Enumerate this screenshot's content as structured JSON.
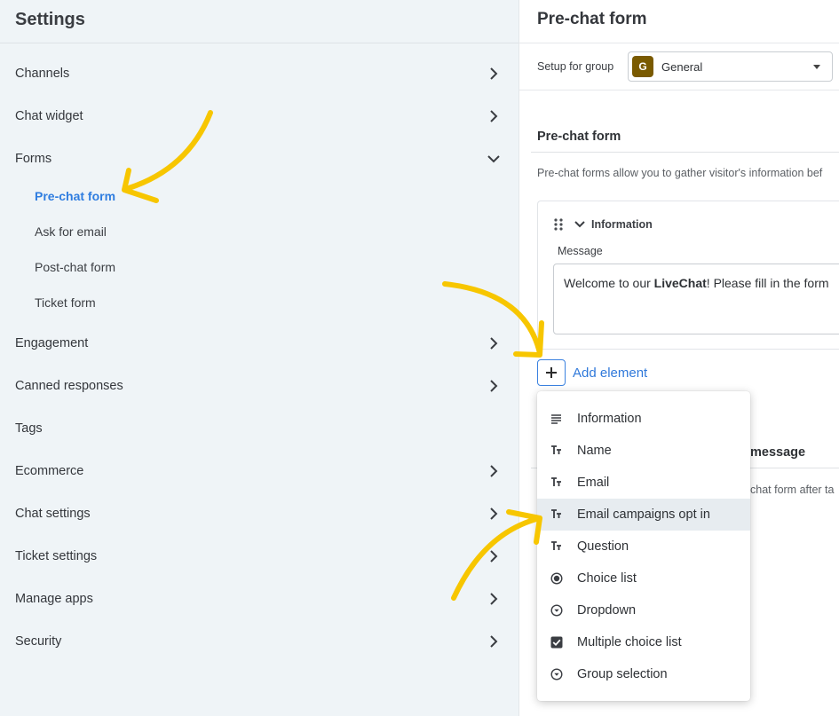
{
  "sidebar": {
    "title": "Settings",
    "items": [
      {
        "label": "Channels",
        "icon": "chevron-right-icon"
      },
      {
        "label": "Chat widget",
        "icon": "chevron-right-icon"
      },
      {
        "label": "Forms",
        "icon": "chevron-down-icon"
      },
      {
        "label": "Engagement",
        "icon": "chevron-right-icon"
      },
      {
        "label": "Canned responses",
        "icon": "chevron-right-icon"
      },
      {
        "label": "Tags"
      },
      {
        "label": "Ecommerce",
        "icon": "chevron-right-icon"
      },
      {
        "label": "Chat settings",
        "icon": "chevron-right-icon"
      },
      {
        "label": "Ticket settings",
        "icon": "chevron-right-icon"
      },
      {
        "label": "Manage apps",
        "icon": "chevron-right-icon"
      },
      {
        "label": "Security",
        "icon": "chevron-right-icon"
      }
    ],
    "forms_subitems": [
      {
        "label": "Pre-chat form",
        "active": true
      },
      {
        "label": "Ask for email"
      },
      {
        "label": "Post-chat form"
      },
      {
        "label": "Ticket form"
      }
    ]
  },
  "main": {
    "title": "Pre-chat form",
    "group_label": "Setup for group",
    "group_avatar": "G",
    "group_value": "General",
    "section_title": "Pre-chat form",
    "section_desc": "Pre-chat forms allow you to gather visitor's information bef",
    "card": {
      "title": "Information",
      "message_label": "Message",
      "message_prefix": "Welcome to our ",
      "message_bold": "LiveChat",
      "message_suffix": "! Please fill in the form"
    },
    "add_element_label": "Add element",
    "behind_title": "message",
    "behind_desc": "chat form after ta"
  },
  "dropdown": {
    "items": [
      {
        "label": "Information",
        "icon": "text-lines-icon"
      },
      {
        "label": "Name",
        "icon": "text-type-icon"
      },
      {
        "label": "Email",
        "icon": "text-type-icon"
      },
      {
        "label": "Email campaigns opt in",
        "icon": "text-type-icon",
        "hover": true
      },
      {
        "label": "Question",
        "icon": "text-type-icon"
      },
      {
        "label": "Choice list",
        "icon": "radio-icon"
      },
      {
        "label": "Dropdown",
        "icon": "dropdown-circle-icon"
      },
      {
        "label": "Multiple choice list",
        "icon": "checkbox-icon"
      },
      {
        "label": "Group selection",
        "icon": "dropdown-circle-icon"
      }
    ]
  },
  "colors": {
    "accent": "#2f7de0",
    "annotation_arrow": "#f7c600",
    "sidebar_bg": "#eff4f7",
    "group_avatar_bg": "#7a5a00"
  }
}
